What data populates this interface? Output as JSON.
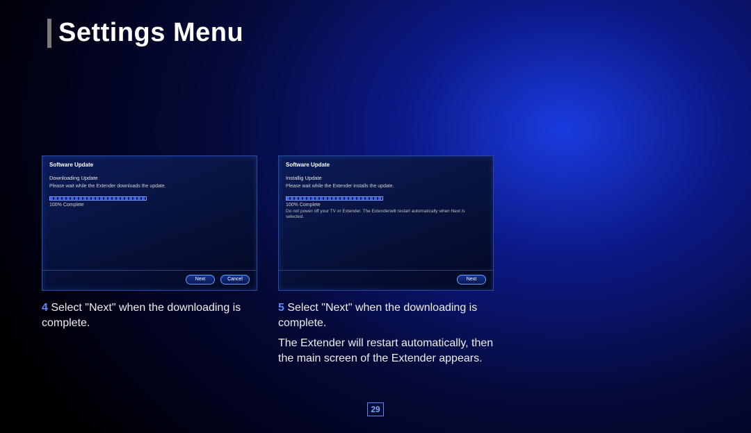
{
  "page": {
    "title": "Settings Menu",
    "number": "29"
  },
  "step4": {
    "number": "4",
    "caption": "Select \"Next\" when the downloading is complete.",
    "dialog": {
      "header": "Software Update",
      "sub": "Downloading Update",
      "msg": "Please wait while the Extender downloads the update.",
      "pct": "100% Complete",
      "next": "Next",
      "cancel": "Cancel"
    }
  },
  "step5": {
    "number": "5",
    "caption": "Select \"Next\" when the downloading is complete.",
    "caption2": "The Extender will restart automatically, then the main screen of the Extender appears.",
    "dialog": {
      "header": "Software Update",
      "sub": "Installig Update",
      "msg": "Please wait while the Extender installs the update.",
      "pct": "100% Complete",
      "note": "Do not power off your TV or Extender. The Extenderwill restart automatically when Next is selected.",
      "next": "Next"
    }
  }
}
